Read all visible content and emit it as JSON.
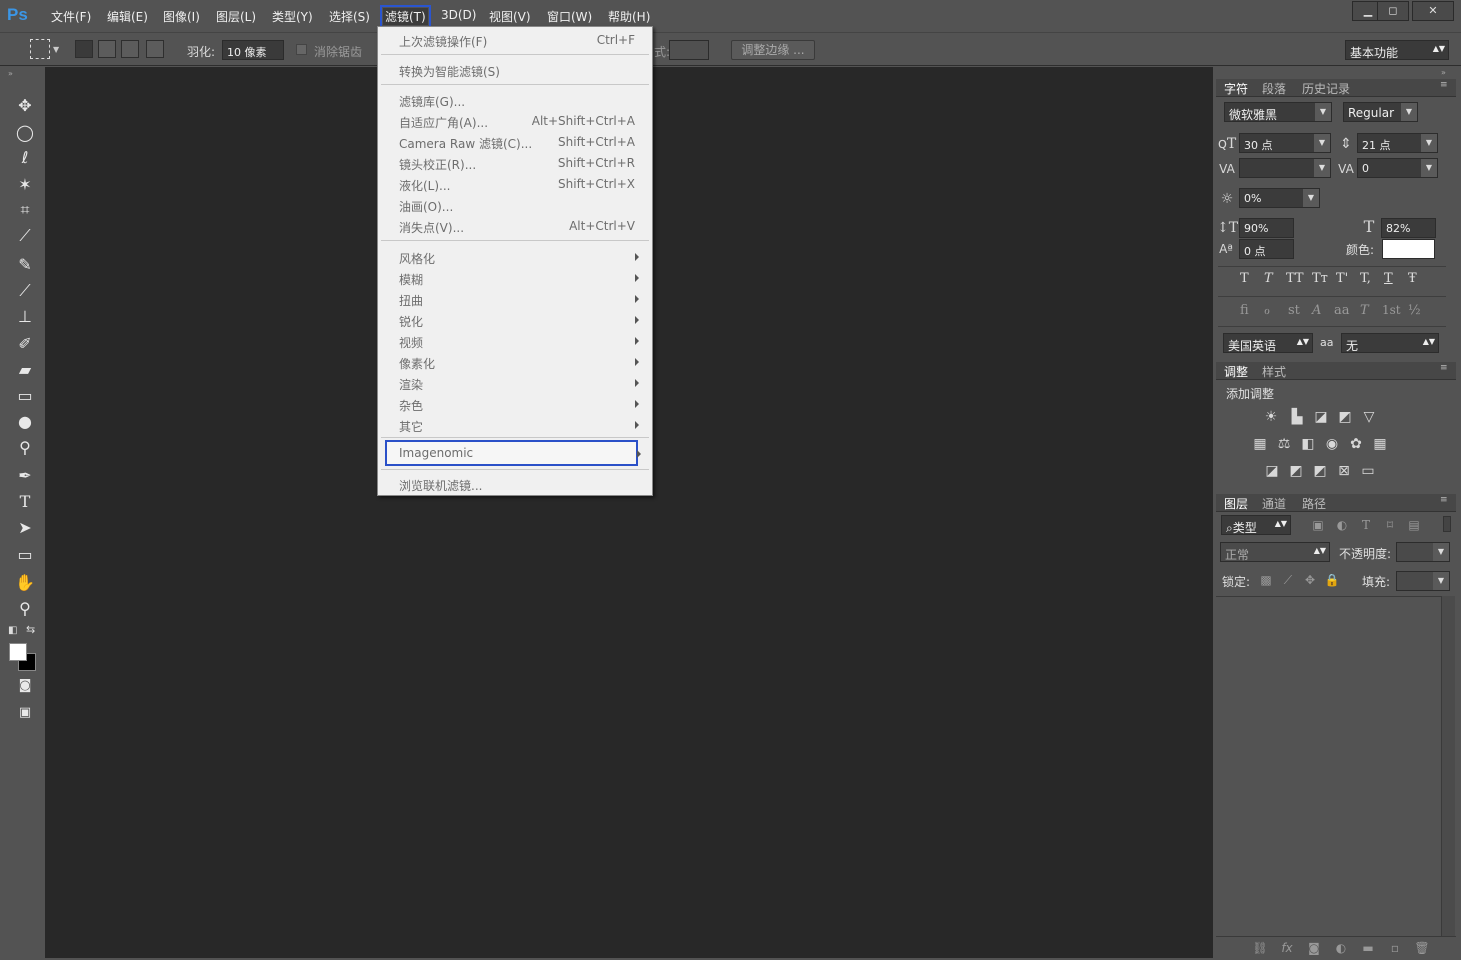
{
  "app": {
    "logo": "Ps"
  },
  "menubar": {
    "items": [
      "文件(F)",
      "编辑(E)",
      "图像(I)",
      "图层(L)",
      "类型(Y)",
      "选择(S)",
      "滤镜(T)",
      "3D(D)",
      "视图(V)",
      "窗口(W)",
      "帮助(H)"
    ],
    "active_index": 6
  },
  "window_controls": {
    "minimize": "▁",
    "maximize": "◻",
    "close": "✕"
  },
  "options_bar": {
    "feather_label": "羽化:",
    "feather_value": "10 像素",
    "antialias_label": "消除锯齿",
    "style_label_fragment": "式:",
    "refine_edge": "调整边缘 ...",
    "workspace": "基本功能"
  },
  "filter_menu": {
    "last_filter": {
      "label": "上次滤镜操作(F)",
      "shortcut": "Ctrl+F"
    },
    "smart": "转换为智能滤镜(S)",
    "group1": [
      {
        "label": "滤镜库(G)...",
        "shortcut": ""
      },
      {
        "label": "自适应广角(A)...",
        "shortcut": "Alt+Shift+Ctrl+A"
      },
      {
        "label": "Camera Raw 滤镜(C)...",
        "shortcut": "Shift+Ctrl+A"
      },
      {
        "label": "镜头校正(R)...",
        "shortcut": "Shift+Ctrl+R"
      },
      {
        "label": "液化(L)...",
        "shortcut": "Shift+Ctrl+X"
      },
      {
        "label": "油画(O)...",
        "shortcut": ""
      },
      {
        "label": "消失点(V)...",
        "shortcut": "Alt+Ctrl+V"
      }
    ],
    "submenus": [
      "风格化",
      "模糊",
      "扭曲",
      "锐化",
      "视频",
      "像素化",
      "渲染",
      "杂色",
      "其它"
    ],
    "imagenomic": "Imagenomic",
    "browse": "浏览联机滤镜..."
  },
  "char_panel": {
    "tabs": [
      "字符",
      "段落",
      "历史记录"
    ],
    "font_family": "微软雅黑",
    "font_style": "Regular",
    "font_size": "30 点",
    "leading": "21 点",
    "kerning": "",
    "tracking": "0",
    "scale_pct": "0%",
    "vscale": "90%",
    "hscale": "82%",
    "baseline": "0 点",
    "color_label": "颜色:",
    "style_buttons": [
      "T",
      "T",
      "TT",
      "Tт",
      "T'",
      "T,",
      "T",
      "Ŧ"
    ],
    "opentype_buttons": [
      "ﬁ",
      "ℴ",
      "st",
      "A",
      "aa",
      "T",
      "1st",
      "½"
    ],
    "language": "美国英语",
    "aa_label": "aa",
    "aa_value": "无"
  },
  "adjust_panel": {
    "tabs": [
      "调整",
      "样式"
    ],
    "title": "添加调整"
  },
  "layers_panel": {
    "tabs": [
      "图层",
      "通道",
      "路径"
    ],
    "filter_kind": "类型",
    "blend_mode": "正常",
    "opacity_label": "不透明度:",
    "lock_label": "锁定:",
    "fill_label": "填充:"
  },
  "colors": {
    "accent_outline": "#2a55d0",
    "foreground": "#ffffff",
    "background": "#000000"
  }
}
